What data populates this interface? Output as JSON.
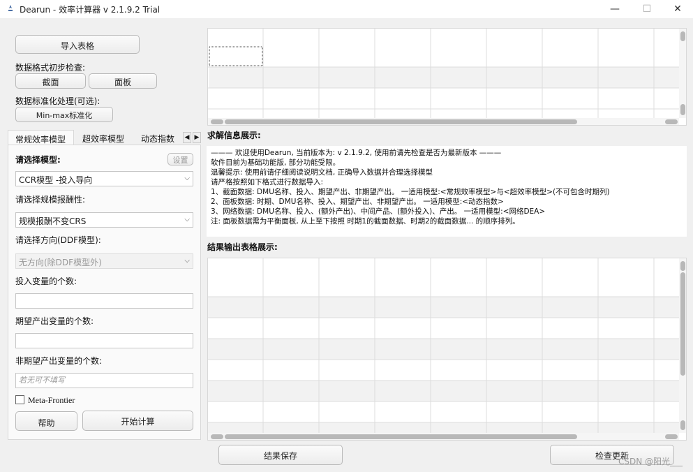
{
  "window": {
    "title": "Dearun  - 效率计算器  v 2.1.9.2 Trial",
    "minimize": "—",
    "maximize": "☐",
    "close": "✕"
  },
  "left": {
    "import_button": "导入表格",
    "format_check_label": "数据格式初步检查:",
    "cross_section_button": "截面",
    "panel_button": "面板",
    "normalize_label": "数据标准化处理(可选):",
    "normalize_button": "Min-max标准化",
    "tabs": [
      "常规效率模型",
      "超效率模型",
      "动态指数"
    ],
    "select_model_label": "请选择模型:",
    "settings_button": "设置",
    "model_value": "CCR模型 -投入导向",
    "scale_label": "请选择规模报酬性:",
    "scale_value": "规模报酬不变CRS",
    "direction_label": "请选择方向(DDF模型):",
    "direction_value": "无方向(除DDF模型外)",
    "input_count_label": "投入变量的个数:",
    "desired_output_label": "期望产出变量的个数:",
    "undesired_output_label": "非期望产出变量的个数:",
    "undesired_placeholder": "若无可不填写",
    "meta_frontier_label": "Meta-Frontier",
    "help_button": "帮助",
    "start_button": "开始计算"
  },
  "right": {
    "solve_info_title": "求解信息展示:",
    "info_lines": [
      "——— 欢迎使用Dearun, 当前版本为: v 2.1.9.2, 使用前请先检查是否为最新版本 ———",
      "软件目前为基础功能版, 部分功能受限。",
      "温馨提示: 使用前请仔细阅读说明文档, 正确导入数据并合理选择模型",
      "请严格按照如下格式进行数据导入:",
      "1、截面数据: DMU名称、投入、期望产出、非期望产出。   一适用模型:<常规效率模型>与<超效率模型>(不可包含时期列)",
      "2、面板数据: 时期、DMU名称、投入、期望产出、非期望产出。   一适用模型:<动态指数>",
      "3、网络数据: DMU名称、投入、(额外产出)、中间产品、(额外投入)、产出。   一适用模型:<网络DEA>",
      "注: 面板数据需为平衡面板, 从上至下按照 时期1的截面数据、时期2的截面数据... 的顺序排列。"
    ],
    "result_table_title": "结果输出表格展示:",
    "save_button": "结果保存",
    "update_button": "检查更新"
  },
  "watermark": "CSDN @阳光___"
}
